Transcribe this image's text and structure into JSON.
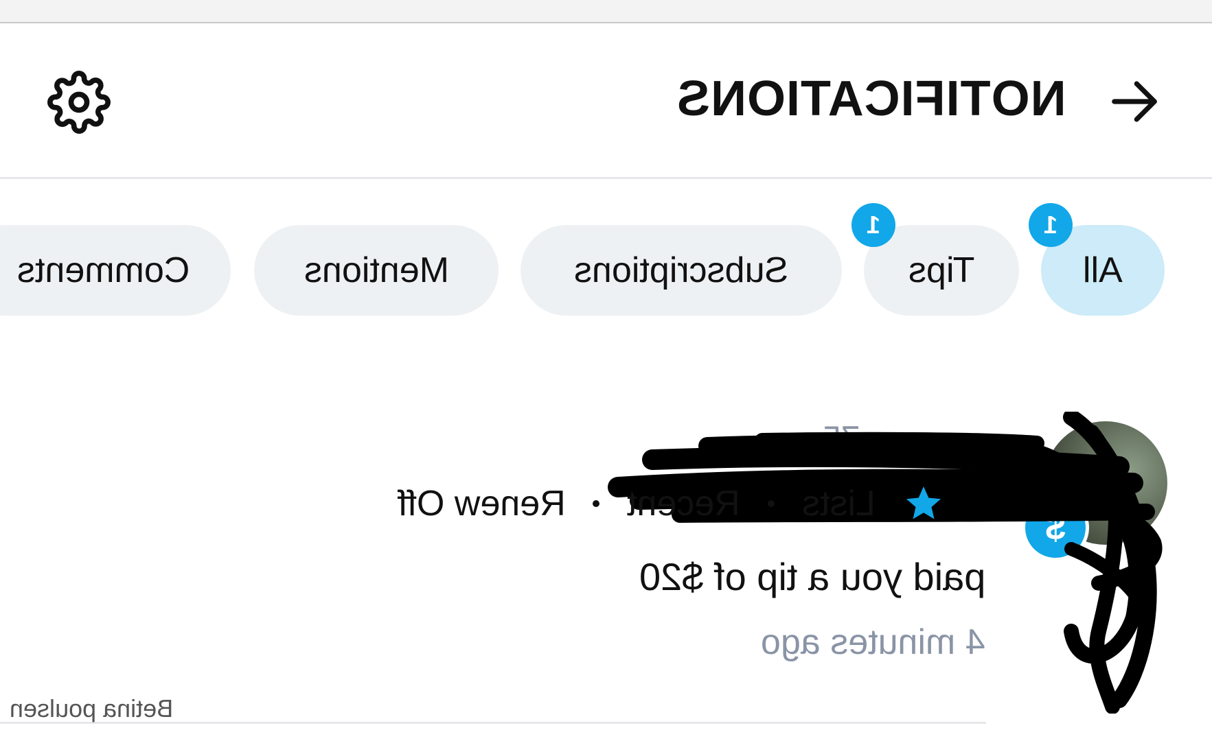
{
  "header": {
    "title": "NOTIFICATIONS",
    "back_icon": "arrow-right-icon",
    "settings_icon": "gear-icon"
  },
  "tabs": [
    {
      "label": "All",
      "badge": "1",
      "active": true
    },
    {
      "label": "Tips",
      "badge": "1",
      "active": false
    },
    {
      "label": "Subscriptions",
      "badge": "",
      "active": false
    },
    {
      "label": "Mentions",
      "badge": "",
      "active": false
    },
    {
      "label": "Comments",
      "badge": "",
      "active": false
    }
  ],
  "notification": {
    "handle_fragment": "75",
    "tip_icon": "dollar-icon",
    "star_icon": "star-icon",
    "meta": {
      "lists": "Lists",
      "recent": "Recent",
      "renew": "Renew Off"
    },
    "message": "paid you a tip of $20",
    "time": "4 minutes ago"
  },
  "watermark": "Betina poulsen",
  "colors": {
    "accent": "#12a7e8",
    "active_tab_bg": "#cdebf8",
    "tab_bg": "#eef1f3",
    "muted_text": "#8a94a6",
    "divider": "#e5e7eb"
  }
}
